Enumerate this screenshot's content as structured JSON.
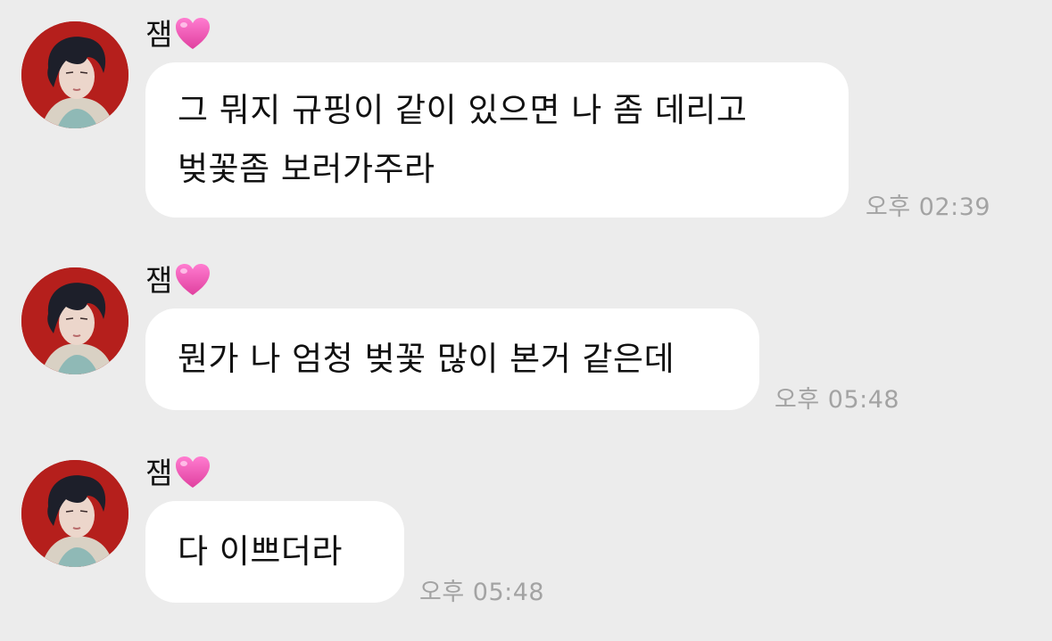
{
  "colors": {
    "background": "#ececec",
    "bubble": "#ffffff",
    "text": "#111111",
    "timestamp": "#a3a3a3",
    "heart": "#e84fb0",
    "avatar_bg": "#b01c1a"
  },
  "messages": [
    {
      "sender": "잼",
      "sender_icon": "pink-heart-icon",
      "lines": [
        "그 뭐지 규핑이 같이 있으면 나 좀 데리고",
        "벚꽃좀 보러가주라"
      ],
      "time": "오후 02:39"
    },
    {
      "sender": "잼",
      "sender_icon": "pink-heart-icon",
      "lines": [
        "뭔가 나 엄청 벚꽃 많이 본거 같은데"
      ],
      "time": "오후 05:48"
    },
    {
      "sender": "잼",
      "sender_icon": "pink-heart-icon",
      "lines": [
        "다 이쁘더라"
      ],
      "time": "오후 05:48"
    }
  ]
}
